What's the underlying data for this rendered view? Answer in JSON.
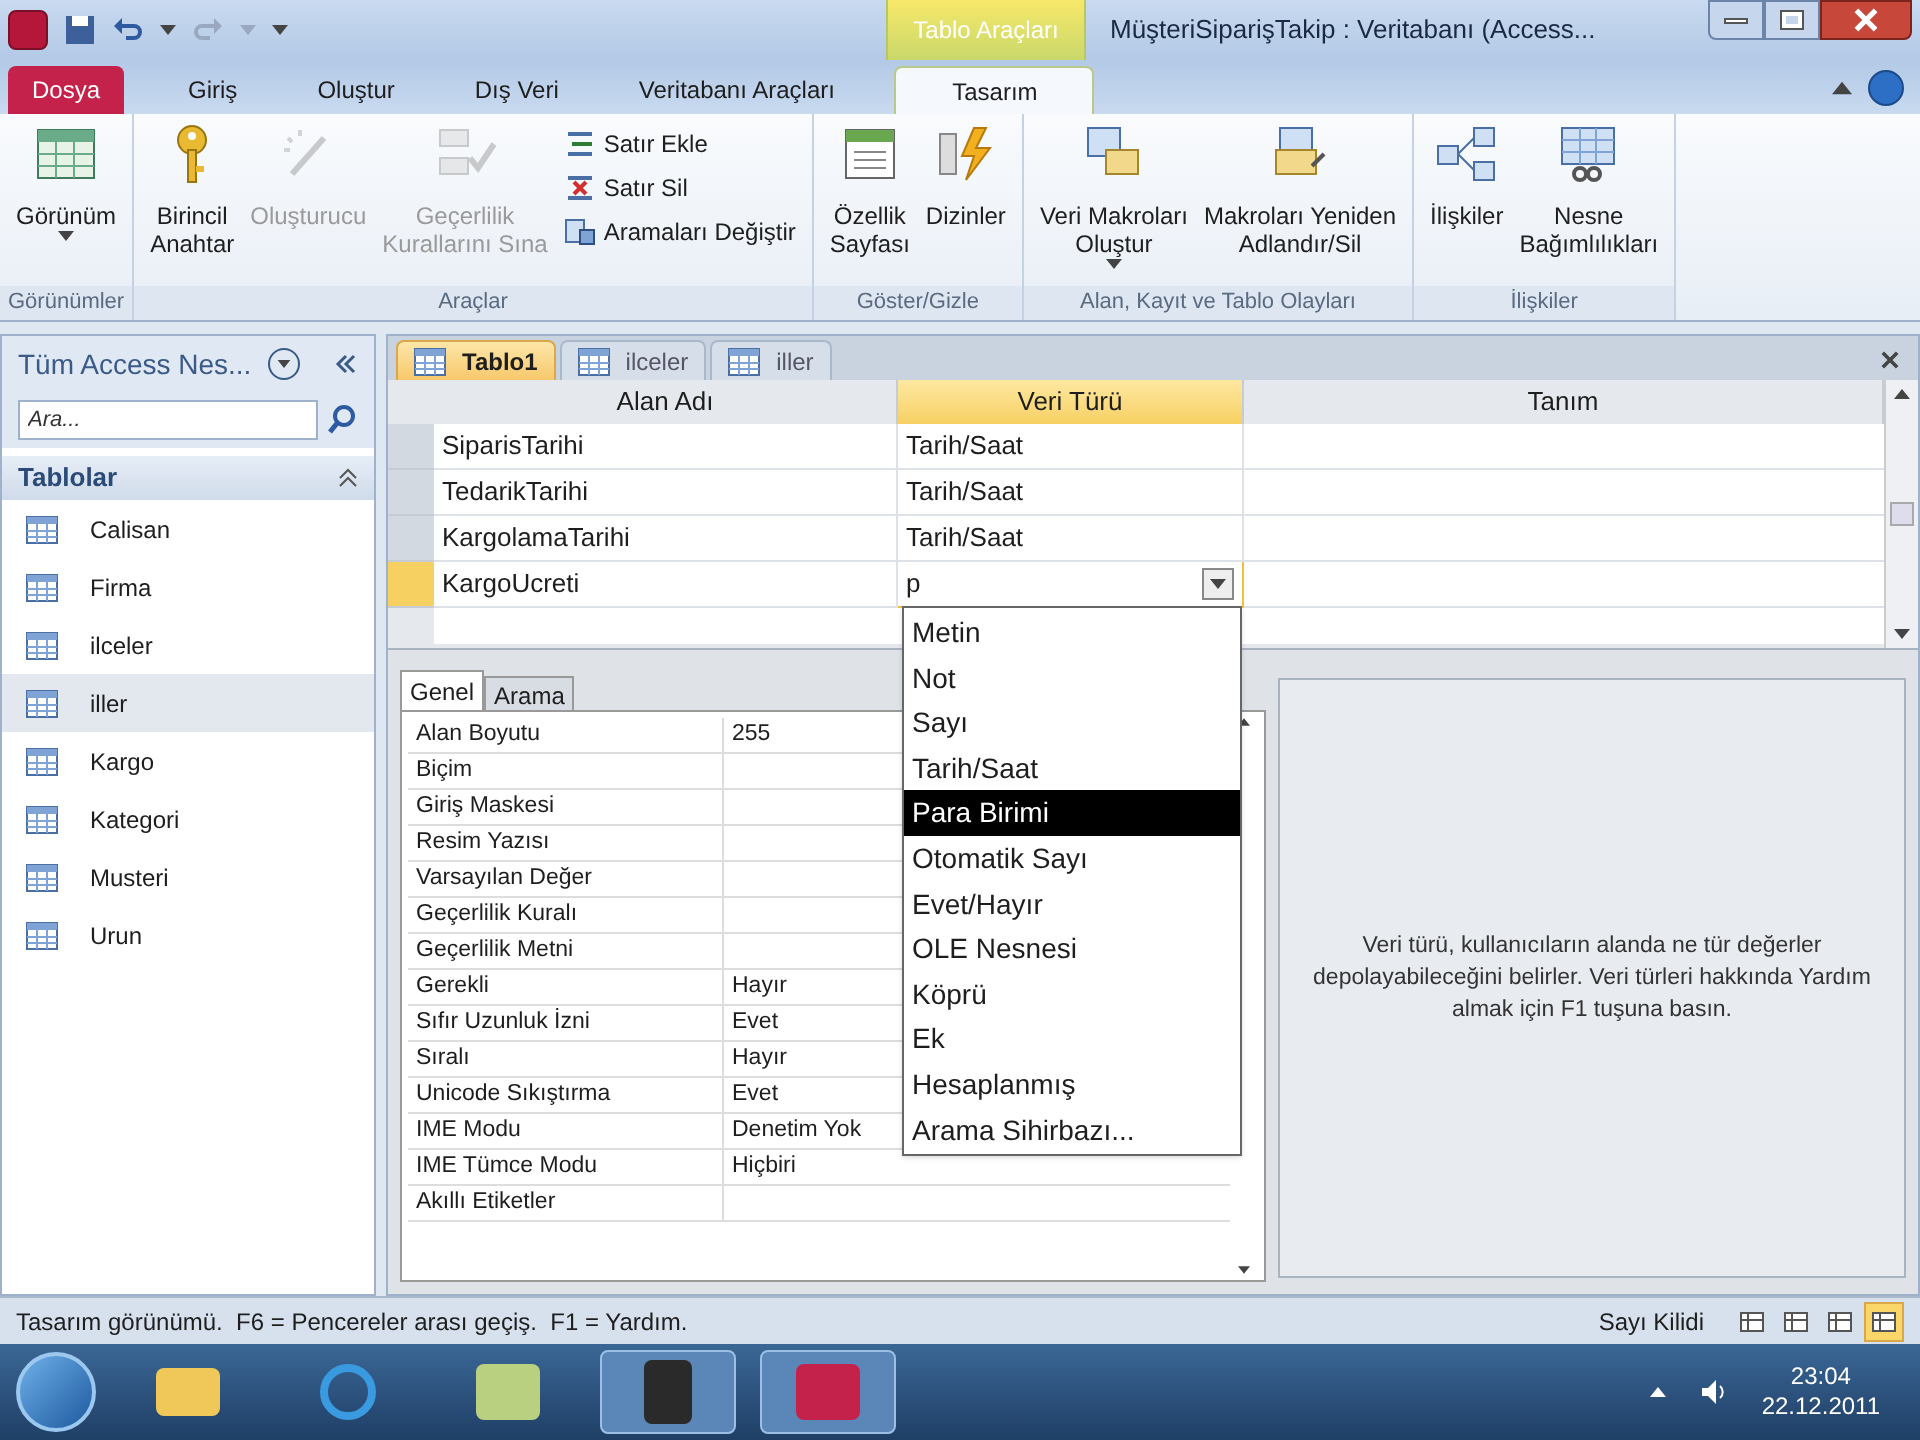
{
  "window": {
    "title": "MüşteriSiparişTakip : Veritabanı (Access...",
    "contextual_tab": "Tablo Araçları"
  },
  "ribbon_tabs": [
    {
      "label": "Dosya",
      "kind": "file",
      "selected": false
    },
    {
      "label": "Giriş",
      "kind": "tab",
      "selected": false
    },
    {
      "label": "Oluştur",
      "kind": "tab",
      "selected": false
    },
    {
      "label": "Dış Veri",
      "kind": "tab",
      "selected": false
    },
    {
      "label": "Veritabanı Araçları",
      "kind": "tab",
      "selected": false
    },
    {
      "label": "Tasarım",
      "kind": "tab",
      "selected": true
    }
  ],
  "ribbon_groups": [
    {
      "label": "Görünümler",
      "items": [
        {
          "label": "Görünüm",
          "kind": "large",
          "dropdown": true,
          "disabled": false
        }
      ]
    },
    {
      "label": "Araçlar",
      "items": [
        {
          "label": "Birincil\nAnahtar",
          "kind": "large",
          "dropdown": false,
          "disabled": false
        },
        {
          "label": "Oluşturucu",
          "kind": "large",
          "dropdown": false,
          "disabled": true
        },
        {
          "label": "Geçerlilik\nKurallarını Sına",
          "kind": "large",
          "dropdown": false,
          "disabled": true
        },
        {
          "label": "Satır Ekle",
          "kind": "small",
          "disabled": false
        },
        {
          "label": "Satır Sil",
          "kind": "small",
          "disabled": false
        },
        {
          "label": "Aramaları Değiştir",
          "kind": "small",
          "disabled": false
        }
      ]
    },
    {
      "label": "Göster/Gizle",
      "items": [
        {
          "label": "Özellik\nSayfası",
          "kind": "large",
          "dropdown": false,
          "disabled": false
        },
        {
          "label": "Dizinler",
          "kind": "large",
          "dropdown": false,
          "disabled": false
        }
      ]
    },
    {
      "label": "Alan, Kayıt ve Tablo Olayları",
      "items": [
        {
          "label": "Veri Makroları\nOluştur",
          "kind": "large",
          "dropdown": true,
          "disabled": false
        },
        {
          "label": "Makroları Yeniden\nAdlandır/Sil",
          "kind": "large",
          "dropdown": false,
          "disabled": false
        }
      ]
    },
    {
      "label": "İlişkiler",
      "items": [
        {
          "label": "İlişkiler",
          "kind": "large",
          "dropdown": false,
          "disabled": false
        },
        {
          "label": "Nesne\nBağımlılıkları",
          "kind": "large",
          "dropdown": false,
          "disabled": false
        }
      ]
    }
  ],
  "nav_pane": {
    "title": "Tüm Access Nes...",
    "search_placeholder": "Ara...",
    "group": {
      "label": "Tablolar",
      "expanded": true
    },
    "items": [
      {
        "label": "Calisan",
        "selected": false
      },
      {
        "label": "Firma",
        "selected": false
      },
      {
        "label": "ilceler",
        "selected": false
      },
      {
        "label": "iller",
        "selected": true
      },
      {
        "label": "Kargo",
        "selected": false
      },
      {
        "label": "Kategori",
        "selected": false
      },
      {
        "label": "Musteri",
        "selected": false
      },
      {
        "label": "Urun",
        "selected": false
      }
    ]
  },
  "doc_tabs": [
    {
      "label": "Tablo1",
      "selected": true
    },
    {
      "label": "ilceler",
      "selected": false
    },
    {
      "label": "iller",
      "selected": false
    }
  ],
  "field_grid": {
    "columns": [
      {
        "label": "Alan Adı",
        "selected": false
      },
      {
        "label": "Veri Türü",
        "selected": true
      },
      {
        "label": "Tanım",
        "selected": false
      }
    ],
    "rows": [
      {
        "field": "SiparisTarihi",
        "type": "Tarih/Saat",
        "selected": false
      },
      {
        "field": "TedarikTarihi",
        "type": "Tarih/Saat",
        "selected": false
      },
      {
        "field": "KargolamaTarihi",
        "type": "Tarih/Saat",
        "selected": false
      },
      {
        "field": "KargoUcreti",
        "type": "p",
        "selected": true
      }
    ]
  },
  "type_dropdown": [
    {
      "label": "Metin",
      "selected": false
    },
    {
      "label": "Not",
      "selected": false
    },
    {
      "label": "Sayı",
      "selected": false
    },
    {
      "label": "Tarih/Saat",
      "selected": false
    },
    {
      "label": "Para Birimi",
      "selected": true
    },
    {
      "label": "Otomatik Sayı",
      "selected": false
    },
    {
      "label": "Evet/Hayır",
      "selected": false
    },
    {
      "label": "OLE Nesnesi",
      "selected": false
    },
    {
      "label": "Köprü",
      "selected": false
    },
    {
      "label": "Ek",
      "selected": false
    },
    {
      "label": "Hesaplanmış",
      "selected": false
    },
    {
      "label": "Arama Sihirbazı...",
      "selected": false
    }
  ],
  "property_tabs": [
    {
      "label": "Genel",
      "selected": true
    },
    {
      "label": "Arama",
      "selected": false
    }
  ],
  "properties": [
    {
      "label": "Alan Boyutu",
      "value": "255"
    },
    {
      "label": "Biçim"
    },
    {
      "label": "Giriş Maskesi"
    },
    {
      "label": "Resim Yazısı"
    },
    {
      "label": "Varsayılan Değer"
    },
    {
      "label": "Geçerlilik Kuralı"
    },
    {
      "label": "Geçerlilik Metni"
    },
    {
      "label": "Gerekli",
      "value": "Hayır"
    },
    {
      "label": "Sıfır Uzunluk İzni",
      "value": "Evet"
    },
    {
      "label": "Sıralı",
      "value": "Hayır"
    },
    {
      "label": "Unicode Sıkıştırma",
      "value": "Evet"
    },
    {
      "label": "IME Modu",
      "value": "Denetim Yok"
    },
    {
      "label": "IME Tümce Modu",
      "value": "Hiçbiri"
    },
    {
      "label": "Akıllı Etiketler"
    }
  ],
  "help_text": "Veri türü, kullanıcıların alanda ne tür değerler depolayabileceğini belirler. Veri türleri hakkında Yardım almak için F1 tuşuna basın.",
  "status_bar": {
    "text": "Tasarım görünümü.  F6 = Pencereler arası geçiş.  F1 = Yardım.",
    "num_lock": "Sayı Kilidi",
    "views": [
      {
        "selected": false
      },
      {
        "selected": false
      },
      {
        "selected": false
      },
      {
        "selected": true
      }
    ]
  },
  "taskbar": {
    "time": "23:04",
    "date": "22.12.2011",
    "apps": [
      {
        "selected": false
      },
      {
        "selected": false
      },
      {
        "selected": false
      },
      {
        "selected": true
      },
      {
        "selected": true
      }
    ]
  }
}
